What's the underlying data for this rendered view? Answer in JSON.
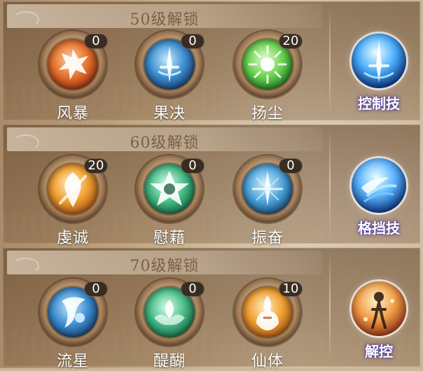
{
  "sections": [
    {
      "title": "50级解锁",
      "skills": [
        {
          "name": "风暴",
          "count": "0",
          "icon": "storm-icon",
          "color": "#e2702a"
        },
        {
          "name": "果决",
          "count": "0",
          "icon": "sword-icon",
          "color": "#3b8ccf"
        },
        {
          "name": "扬尘",
          "count": "20",
          "icon": "burst-icon",
          "color": "#64cf4b"
        }
      ],
      "type_label": "控制技",
      "type_icon": "control-sword-icon"
    },
    {
      "title": "60级解锁",
      "skills": [
        {
          "name": "虔诚",
          "count": "20",
          "icon": "flame-sword-icon",
          "color": "#f0a234"
        },
        {
          "name": "慰藉",
          "count": "0",
          "icon": "star-knot-icon",
          "color": "#43b884"
        },
        {
          "name": "振奋",
          "count": "0",
          "icon": "blade-star-icon",
          "color": "#4aa0d6"
        }
      ],
      "type_label": "格挡技",
      "type_icon": "block-wave-icon"
    },
    {
      "title": "70级解锁",
      "skills": [
        {
          "name": "流星",
          "count": "0",
          "icon": "meteor-icon",
          "color": "#3b8ccf"
        },
        {
          "name": "醍醐",
          "count": "0",
          "icon": "lotus-drop-icon",
          "color": "#43b884"
        },
        {
          "name": "仙体",
          "count": "10",
          "icon": "spirit-body-icon",
          "color": "#f0a234"
        }
      ],
      "type_label": "解控",
      "type_icon": "release-figure-icon"
    }
  ]
}
